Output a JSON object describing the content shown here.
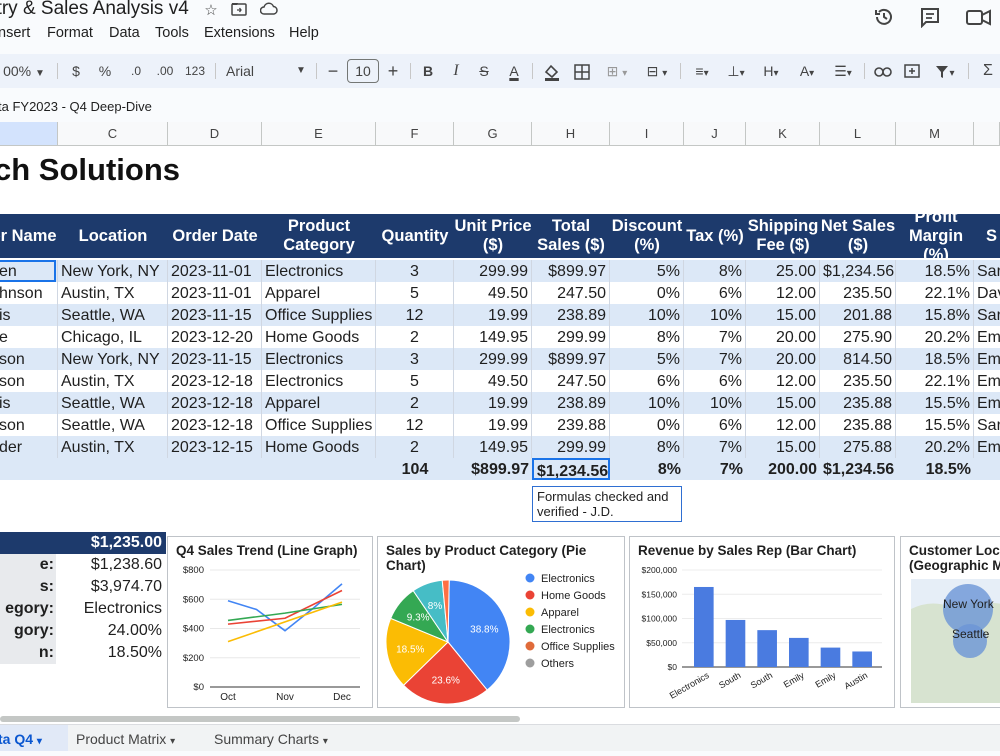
{
  "app": {
    "doc_title": "ntry & Sales Analysis v4",
    "menu": [
      "nsert",
      "Format",
      "Data",
      "Tools",
      "Extensions",
      "Help"
    ],
    "icons": [
      "star-icon",
      "move-icon",
      "cloud-icon",
      "history-icon",
      "comments-icon",
      "meet-icon"
    ]
  },
  "toolbar": {
    "zoom": "00%",
    "currency": "$",
    "percent": "%",
    "dec_decrease": ".0",
    "dec_increase": ".00",
    "number_format": "123",
    "font": "Arial",
    "font_size": "10",
    "bold": "B",
    "italic": "I",
    "strike": "S",
    "text_color": "A"
  },
  "formula_bar": {
    "range_label": "ta FY2023 - Q4 Deep-Dive"
  },
  "grid": {
    "columns": [
      "C",
      "D",
      "E",
      "F",
      "G",
      "H",
      "I",
      "J",
      "K",
      "L",
      "M"
    ],
    "company": "ch Solutions",
    "headers": [
      "er Name",
      "Location",
      "Order Date",
      "Product\nCategory",
      "Quantity",
      "Unit Price\n($)",
      "Total\nSales ($)",
      "Discount\n(%)",
      "Tax (%)",
      "Shipping\nFee ($)",
      "Net Sales\n($)",
      "Profit\nMargin (%)",
      "S"
    ],
    "rows": [
      [
        "en",
        "New York, NY",
        "2023-11-01",
        "Electronics",
        "3",
        "299.99",
        "$899.97",
        "5%",
        "8%",
        "25.00",
        "$1,234.56",
        "18.5%",
        "Sar"
      ],
      [
        "hnson",
        "Austin, TX",
        "2023-11-01",
        "Apparel",
        "5",
        "49.50",
        "247.50",
        "0%",
        "6%",
        "12.00",
        "235.50",
        "22.1%",
        "Dav"
      ],
      [
        "is",
        "Seattle, WA",
        "2023-11-15",
        "Office Supplies",
        "12",
        "19.99",
        "238.89",
        "10%",
        "10%",
        "15.00",
        "201.88",
        "15.8%",
        "Sar"
      ],
      [
        "e",
        "Chicago, IL",
        "2023-12-20",
        "Home Goods",
        "2",
        "149.95",
        "299.99",
        "8%",
        "7%",
        "20.00",
        "275.90",
        "20.2%",
        "Em"
      ],
      [
        "son",
        "New York, NY",
        "2023-11-15",
        "Electronics",
        "3",
        "299.99",
        "$899.97",
        "5%",
        "7%",
        "20.00",
        "814.50",
        "18.5%",
        "Em"
      ],
      [
        "son",
        "Austin, TX",
        "2023-12-18",
        "Electronics",
        "5",
        "49.50",
        "247.50",
        "6%",
        "6%",
        "12.00",
        "235.50",
        "22.1%",
        "Em"
      ],
      [
        "is",
        "Seattle, WA",
        "2023-12-18",
        "Apparel",
        "2",
        "19.99",
        "238.89",
        "10%",
        "10%",
        "15.00",
        "235.88",
        "15.5%",
        "Em"
      ],
      [
        "son",
        "Seattle, WA",
        "2023-12-18",
        "Office Supplies",
        "12",
        "19.99",
        "239.88",
        "0%",
        "6%",
        "12.00",
        "235.88",
        "15.5%",
        "Sar"
      ],
      [
        "der",
        "Austin, TX",
        "2023-12-15",
        "Home Goods",
        "2",
        "149.95",
        "299.99",
        "8%",
        "7%",
        "15.00",
        "275.88",
        "20.2%",
        "Em"
      ]
    ],
    "totals": [
      "104",
      "$899.97",
      "$1,234.56",
      "8%",
      "7%",
      "200.00",
      "$1,234.56",
      "18.5%"
    ],
    "note": "Formulas checked and verified - J.D."
  },
  "summary": {
    "labels": [
      "e:",
      "s:",
      "egory:",
      "gory:",
      "n:"
    ],
    "first_value": "$1,235.00",
    "values": [
      "$1,238.60",
      "$3,974.70",
      "Electronics",
      "24.00%",
      "18.50%"
    ]
  },
  "charts": {
    "line": {
      "title": "Q4 Sales Trend (Line Graph)",
      "y_ticks": [
        "$800",
        "$600",
        "$400",
        "$200",
        "$0"
      ],
      "x_ticks": [
        "Oct",
        "Nov",
        "Dec"
      ]
    },
    "pie": {
      "title": "Sales by Product Category (Pie Chart)",
      "legend": [
        "Electronics",
        "Home Goods",
        "Apparel",
        "Electronics",
        "Office Supplies",
        "Others"
      ],
      "labels": [
        "38.8%",
        "23.6%",
        "18.5%",
        "9.3%",
        "8%"
      ]
    },
    "bar": {
      "title": "Revenue by Sales Rep (Bar Chart)",
      "y_ticks": [
        "$200,000",
        "$150,000",
        "$100,000",
        "$50,000",
        "$0"
      ],
      "x_ticks": [
        "Electronics",
        "South",
        "South",
        "Emily",
        "Emily",
        "Austin"
      ]
    },
    "map": {
      "title": "Customer Loca (Geographic M",
      "labels": [
        "New York",
        "Seattle"
      ]
    }
  },
  "chart_data": [
    {
      "type": "line",
      "title": "Q4 Sales Trend (Line Graph)",
      "categories": [
        "Oct",
        "Nov",
        "Dec"
      ],
      "ylim": [
        0,
        800
      ],
      "series": [
        {
          "color": "#4285f4",
          "x": [
            0,
            0.5,
            1,
            1.5,
            2
          ],
          "values": [
            590,
            530,
            385,
            540,
            705
          ]
        },
        {
          "color": "#ea4335",
          "x": [
            0,
            1,
            2
          ],
          "values": [
            430,
            470,
            660
          ]
        },
        {
          "color": "#34a853",
          "x": [
            0,
            1,
            2
          ],
          "values": [
            455,
            505,
            565
          ]
        },
        {
          "color": "#fbbc04",
          "x": [
            0,
            2
          ],
          "values": [
            310,
            580
          ]
        }
      ]
    },
    {
      "type": "pie",
      "title": "Sales by Product Category (Pie Chart)",
      "slices": [
        {
          "label": "38.8%",
          "value": 38.8,
          "color": "#4285f4"
        },
        {
          "label": "23.6%",
          "value": 23.6,
          "color": "#ea4335"
        },
        {
          "label": "18.5%",
          "value": 18.5,
          "color": "#fbbc04"
        },
        {
          "label": "9.3%",
          "value": 9.3,
          "color": "#34a853"
        },
        {
          "label": "8%",
          "value": 8,
          "color": "#46bdc6"
        }
      ]
    },
    {
      "type": "bar",
      "title": "Revenue by Sales Rep (Bar Chart)",
      "categories": [
        "Electronics",
        "South",
        "South",
        "Emily",
        "Emily",
        "Austin"
      ],
      "values": [
        165000,
        97000,
        76000,
        60000,
        40000,
        32000
      ],
      "ylim": [
        0,
        200000
      ],
      "color": "#4a7be0"
    }
  ]
}
